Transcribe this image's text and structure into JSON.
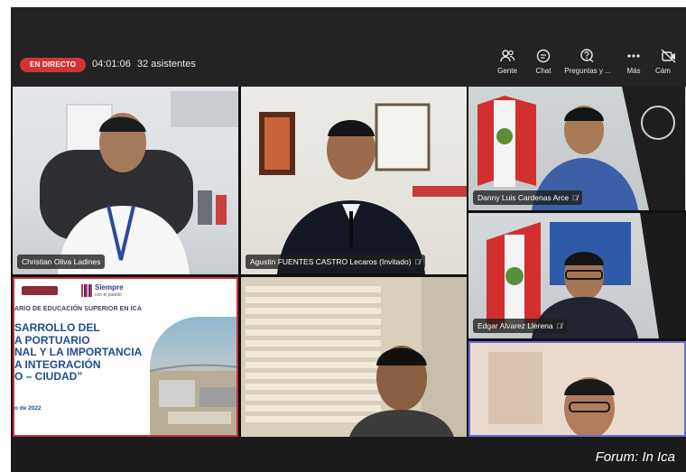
{
  "meeting": {
    "live_label": "EN DIRECTO",
    "elapsed": "04:01:06",
    "attendees": "32 asistentes"
  },
  "toolbar": {
    "items": [
      {
        "label": "Gente",
        "icon": "people-icon"
      },
      {
        "label": "Chat",
        "icon": "chat-icon"
      },
      {
        "label": "Preguntas y ...",
        "icon": "questions-icon"
      },
      {
        "label": "Más",
        "icon": "more-icon"
      },
      {
        "label": "Cám",
        "icon": "camera-icon"
      }
    ]
  },
  "participants": [
    {
      "name": "Christian Oliva Ladines",
      "muted": false
    },
    {
      "name": "Agustin FUENTES CASTRO Lecaros (Invitado)",
      "muted": true
    },
    {
      "name": "Danny Luis Cardenas Arce",
      "muted": true
    },
    {
      "name": "Edgar Alvarez Llerena",
      "muted": true
    },
    {
      "name": "",
      "muted": false
    },
    {
      "name": "",
      "muted": false
    }
  ],
  "shared_slide": {
    "logo_text": "Siempre",
    "logo_subtext": "con el pueblo",
    "kicker": "ARIO DE EDUCACIÓN SUPERIOR EN ICA",
    "title_lines": [
      "SARROLLO DEL",
      "A PORTUARIO",
      "NAL Y LA IMPORTANCIA",
      "A INTEGRACIÓN",
      "O – CIUDAD”"
    ],
    "date": "o de 2022"
  },
  "caption": "Forum: In Ica",
  "colors": {
    "live": "#d13438",
    "active_speaker_border": "#6a6ad8",
    "presenter_border": "#c4313c",
    "slide_title": "#1f4d8c"
  }
}
